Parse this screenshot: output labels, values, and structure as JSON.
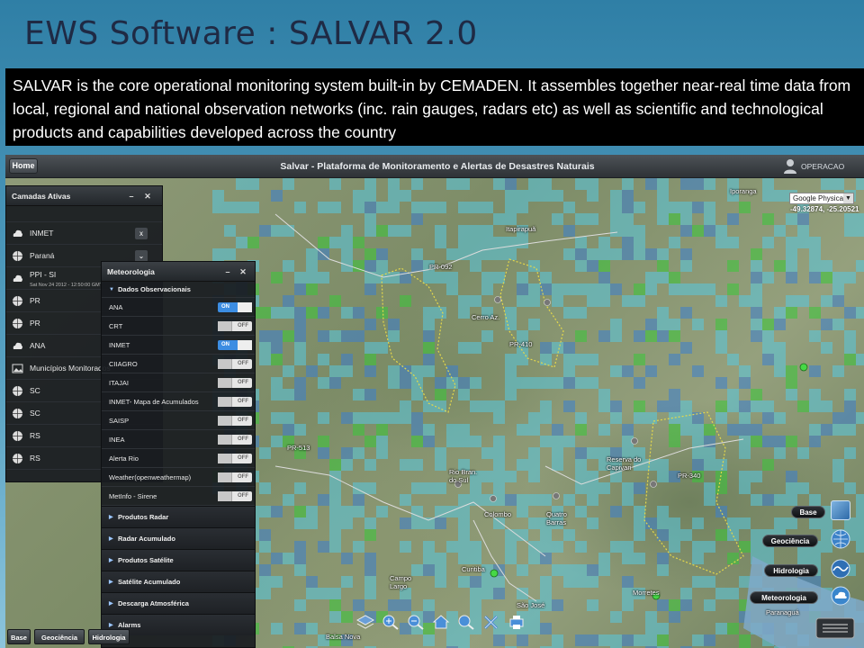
{
  "slide": {
    "title": "EWS Software : SALVAR 2.0",
    "description": "SALVAR is the core operational monitoring system built-in by CEMADEN. It assembles together near-real time data from local, regional and national observation networks (inc. rain gauges, radars etc) as well as scientific and technological products and capabilities developed across the country"
  },
  "app": {
    "home_label": "Home",
    "title": "Salvar - Plataforma de Monitoramento e Alertas de Desastres Naturais",
    "user_label": "OPERACAO",
    "map_type": "Google Physical",
    "coordinates": "-49.32874,  -25.20521",
    "map_labels": [
      "PR-092",
      "Cerro Az.",
      "Itapirapuã",
      "Iporanga",
      "PR-513",
      "Rio Bran. do Sul",
      "Colombo",
      "Quatro Barras",
      "Campo Largo",
      "Curitiba",
      "São José",
      "Reserva do Capivari",
      "Morretes",
      "Paranaguá",
      "Balsa Nova",
      "PR-340",
      "PR-410"
    ]
  },
  "layers_panel": {
    "title": "Camadas Ativas",
    "minimize": "–",
    "close": "✕",
    "items": [
      {
        "label": "INMET",
        "icon": "cloud-icon",
        "sub": ""
      },
      {
        "label": "Paraná",
        "icon": "globe-icon",
        "sub": ""
      },
      {
        "label": "PPI - SI",
        "icon": "cloud-icon",
        "sub": "Sat Nov 24 2012 - 12:50:00 GMT"
      },
      {
        "label": "PR",
        "icon": "globe-icon",
        "sub": ""
      },
      {
        "label": "PR",
        "icon": "globe-icon",
        "sub": ""
      },
      {
        "label": "ANA",
        "icon": "cloud-icon",
        "sub": ""
      },
      {
        "label": "Municípios Monitorados",
        "icon": "image-icon",
        "sub": ""
      },
      {
        "label": "SC",
        "icon": "globe-icon",
        "sub": ""
      },
      {
        "label": "SC",
        "icon": "globe-icon",
        "sub": ""
      },
      {
        "label": "RS",
        "icon": "globe-icon",
        "sub": ""
      },
      {
        "label": "RS",
        "icon": "globe-icon",
        "sub": ""
      }
    ]
  },
  "meteo_panel": {
    "title": "Meteorologia",
    "minimize": "–",
    "close": "✕",
    "section": "Dados Observacionais",
    "rows": [
      {
        "label": "ANA",
        "state": "ON"
      },
      {
        "label": "CRT",
        "state": "OFF"
      },
      {
        "label": "INMET",
        "state": "ON"
      },
      {
        "label": "CIIAGRO",
        "state": "OFF"
      },
      {
        "label": "ITAJAI",
        "state": "OFF"
      },
      {
        "label": "INMET- Mapa de Acumulados",
        "state": "OFF"
      },
      {
        "label": "SAISP",
        "state": "OFF"
      },
      {
        "label": "INEA",
        "state": "OFF"
      },
      {
        "label": "Alerta Rio",
        "state": "OFF"
      },
      {
        "label": "Weather(openweathermap)",
        "state": "OFF"
      },
      {
        "label": "MetInfo - Sirene",
        "state": "OFF"
      }
    ],
    "subsections": [
      "Produtos Radar",
      "Radar Acumulado",
      "Produtos Satélite",
      "Satélite Acumulado",
      "Descarga Atmosférica",
      "Alarms"
    ]
  },
  "side_menu": [
    "Base",
    "Geociência",
    "Hidrologia",
    "Meteorologia"
  ],
  "bottom_tabs": [
    "Base",
    "Geociência",
    "Hidrologia"
  ],
  "toolbar_icons": [
    "layers-icon",
    "zoom-in-icon",
    "zoom-out-icon",
    "home-map-icon",
    "search-icon",
    "tools-icon",
    "print-icon"
  ],
  "colors": {
    "title": "#1f2a44",
    "panel_bg": "#191c20",
    "toggle_on": "#3c8de2",
    "radar_light": "#58c8e0",
    "radar_mid": "#3a7fd0",
    "radar_green": "#38c838"
  }
}
